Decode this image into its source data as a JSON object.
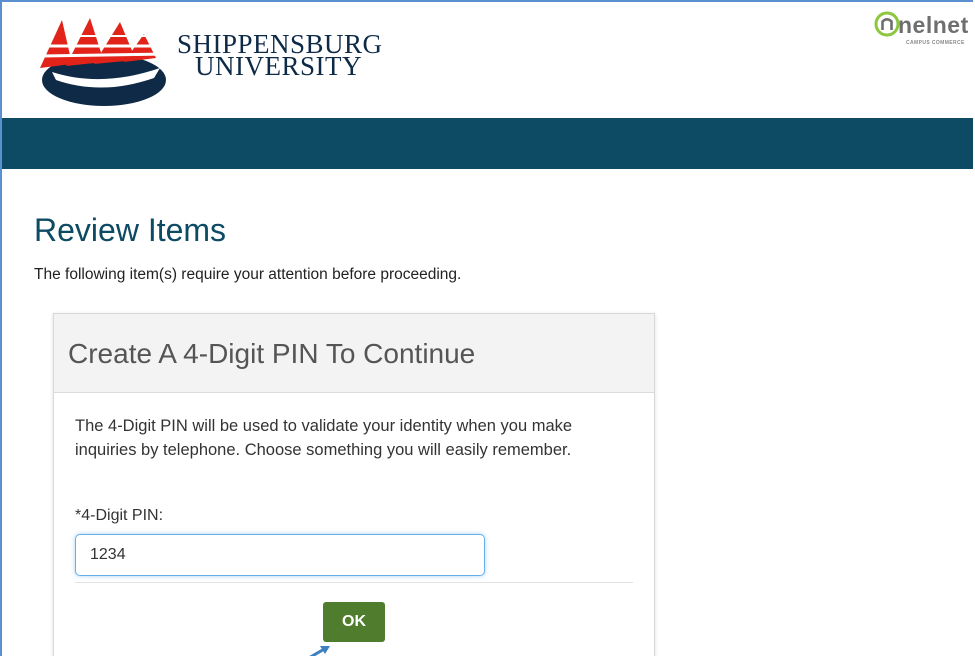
{
  "header": {
    "university_name_line1": "SHIPPENSBURG",
    "university_name_line2": "UNIVERSITY",
    "partner_logo_text": "nelnet",
    "partner_logo_subtext": "CAMPUS COMMERCE",
    "colors": {
      "navbar": "#0d4a63",
      "logo_red": "#e2231a",
      "logo_navy": "#0e2a47",
      "nelnet_green": "#8dc63f"
    }
  },
  "page": {
    "title": "Review Items",
    "subtitle": "The following item(s) require your attention before proceeding."
  },
  "pin_card": {
    "title": "Create A 4-Digit PIN To Continue",
    "description": "The 4-Digit PIN will be used to validate your identity when you make inquiries by telephone. Choose something you will easily remember.",
    "pin_label": "*4-Digit PIN:",
    "pin_value": "1234",
    "ok_label": "OK",
    "colors": {
      "ok_button": "#4f7d2d",
      "input_focus": "#66afe9"
    }
  }
}
